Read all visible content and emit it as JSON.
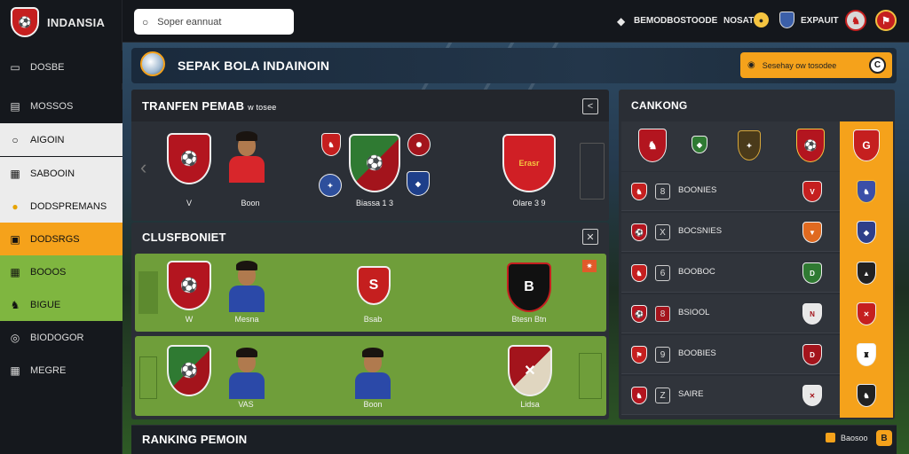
{
  "brand": {
    "name": "INDANSIA"
  },
  "sidebar": {
    "items": [
      {
        "label": "DOSBE",
        "icon": "monitor-icon"
      },
      {
        "label": "MOSSOS",
        "icon": "newspaper-icon"
      },
      {
        "label": "AIGOIN",
        "icon": "circle-icon"
      },
      {
        "label": "SABOOIN",
        "icon": "calendar-icon"
      },
      {
        "label": "DODSPREMANS",
        "icon": "football-icon"
      },
      {
        "label": "DODSRGS",
        "icon": "grid-icon"
      },
      {
        "label": "BOOOS",
        "icon": "calendar-icon"
      },
      {
        "label": "BIGUE",
        "icon": "trophy-icon"
      },
      {
        "label": "BIODOGOR",
        "icon": "circle-icon"
      },
      {
        "label": "MEGRE",
        "icon": "grid-icon"
      }
    ]
  },
  "search": {
    "placeholder": "Soper eannuat"
  },
  "topbar": {
    "item1": "BEMODBOSTOODE",
    "item2": "NOSAT",
    "item3": "EXPAUIT"
  },
  "header": {
    "title": "SEPAK BOLA INDAINOIN",
    "button_label": "Sesehay  ow tosodee",
    "coin": "C"
  },
  "transfer": {
    "title": "TRANFEN PEMAB",
    "subtitle": "w tosee",
    "left_label": "V",
    "player_label": "Boon",
    "center_label": "Biassa 1 3",
    "right_label": "Olare 3 9",
    "right_crest_text": "Erasr"
  },
  "clubs": {
    "title": "CLUSFBONIET",
    "row1": {
      "labels": [
        "W",
        "Mesna",
        "Bsab",
        "Btesn Btn"
      ]
    },
    "row2": {
      "labels": [
        "VAS",
        "Boon",
        "Lidsa"
      ]
    }
  },
  "rankings": {
    "title": "CANKONG",
    "rows": [
      {
        "num": "8",
        "name": "BOONIES"
      },
      {
        "num": "X",
        "name": "BOCSNIES"
      },
      {
        "num": "6",
        "name": "BOOBOC"
      },
      {
        "num": "8",
        "name": "BSIOOL"
      },
      {
        "num": "9",
        "name": "BOOBIES"
      },
      {
        "num": "Z",
        "name": "SAIRE"
      }
    ]
  },
  "bottom": {
    "title": "RANKING PEMOIN",
    "button_label": "Baosoo",
    "button_icon": "B"
  },
  "colors": {
    "accent": "#f5a21b",
    "green": "#7fb640",
    "red": "#c51f1f",
    "panel": "#2b2f36"
  }
}
